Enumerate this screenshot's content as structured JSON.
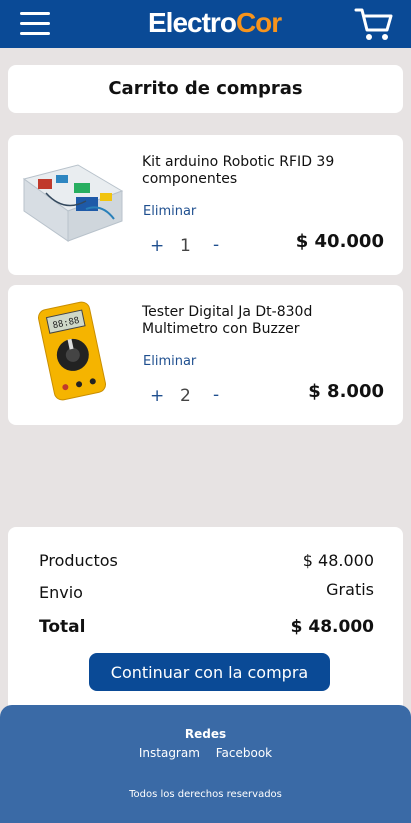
{
  "header": {
    "logo_part1": "Electro",
    "logo_part2": "Cor",
    "menu_icon": "hamburger-menu-icon",
    "cart_icon": "shopping-cart-icon",
    "brand_color": "#0a4a96",
    "accent_color": "#f7941d"
  },
  "page": {
    "title": "Carrito de compras"
  },
  "cart": {
    "items": [
      {
        "name": "Kit arduino Robotic RFID 39 componentes",
        "remove_label": "Eliminar",
        "increment_label": "+",
        "quantity": "1",
        "decrement_label": "-",
        "price": "$ 40.000",
        "image_icon": "arduino-kit-image"
      },
      {
        "name": "Tester Digital Ja Dt-830d Multimetro con Buzzer",
        "remove_label": "Eliminar",
        "increment_label": "+",
        "quantity": "2",
        "decrement_label": "-",
        "price": "$ 8.000",
        "image_icon": "multimeter-image"
      }
    ]
  },
  "summary": {
    "products_label": "Productos",
    "products_value": "$ 48.000",
    "shipping_label": "Envio",
    "shipping_value": "Gratis",
    "total_label": "Total",
    "total_value": "$ 48.000",
    "continue_label": "Continuar con la compra"
  },
  "footer": {
    "social_title": "Redes",
    "links": [
      "Instagram",
      "Facebook"
    ],
    "rights": "Todos los derechos reservados"
  }
}
